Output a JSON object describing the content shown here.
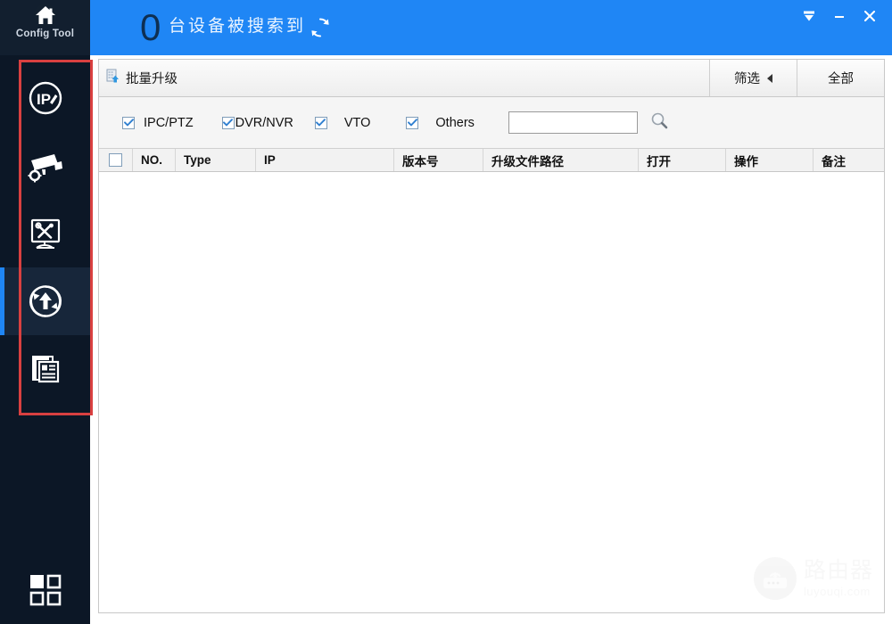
{
  "app": {
    "brand_label": "Config Tool",
    "brand_icon": "home-icon"
  },
  "header": {
    "device_count": "0",
    "count_text": "台设备被搜索到",
    "refresh_icon": "refresh-icon",
    "window_buttons": [
      {
        "name": "filter-funnel-button",
        "icon": "funnel-icon",
        "label": ""
      },
      {
        "name": "minimize-button",
        "icon": "minimize-icon",
        "label": ""
      },
      {
        "name": "close-button",
        "icon": "close-icon",
        "label": ""
      }
    ],
    "accent_color": "#1f86f5"
  },
  "sidebar": {
    "background_color": "#0c1726",
    "selected_index": 3,
    "items": [
      {
        "name": "sidebar-item-ip-modify",
        "icon": "ip-circle-icon",
        "label": ""
      },
      {
        "name": "sidebar-item-device-config",
        "icon": "camera-gear-icon",
        "label": ""
      },
      {
        "name": "sidebar-item-system-tools",
        "icon": "monitor-tools-icon",
        "label": ""
      },
      {
        "name": "sidebar-item-upgrade",
        "icon": "upload-refresh-icon",
        "label": ""
      },
      {
        "name": "sidebar-item-logs",
        "icon": "documents-icon",
        "label": ""
      }
    ],
    "bottom_item": {
      "name": "sidebar-item-apps-grid",
      "icon": "grid-icon",
      "label": ""
    },
    "annotation_box_color": "#d94040"
  },
  "toolbar": {
    "batch_upgrade_label": "批量升级",
    "batch_upgrade_icon": "batch-upgrade-icon",
    "filter_label": "筛选",
    "filter_caret_icon": "triangle-left-icon",
    "all_label": "全部"
  },
  "filters": {
    "checkboxes": [
      {
        "label": "IPC/PTZ",
        "checked": true
      },
      {
        "label": "DVR/NVR",
        "checked": true
      },
      {
        "label": "VTO",
        "checked": true
      },
      {
        "label": "Others",
        "checked": true
      }
    ],
    "search": {
      "value": "",
      "placeholder": "",
      "icon": "search-icon"
    }
  },
  "table": {
    "select_all_checked": false,
    "columns": [
      {
        "key": "select",
        "label": ""
      },
      {
        "key": "no",
        "label": "NO."
      },
      {
        "key": "type",
        "label": "Type"
      },
      {
        "key": "ip",
        "label": "IP"
      },
      {
        "key": "version",
        "label": "版本号"
      },
      {
        "key": "path",
        "label": "升级文件路径"
      },
      {
        "key": "open",
        "label": "打开"
      },
      {
        "key": "action",
        "label": "操作"
      },
      {
        "key": "remark",
        "label": "备注"
      }
    ],
    "rows": []
  },
  "watermark": {
    "cn": "路由器",
    "en": "luyouqi.com",
    "icon": "router-icon"
  }
}
